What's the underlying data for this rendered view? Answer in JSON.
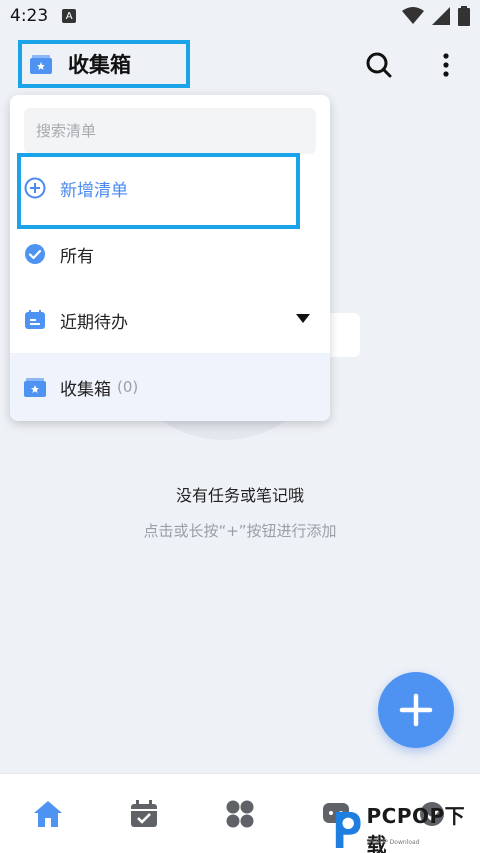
{
  "status_bar": {
    "time": "4:23",
    "notification_icon_letter": "A"
  },
  "app_bar": {
    "title": "收集箱",
    "title_icon": "inbox-star-icon",
    "actions": [
      "search-icon",
      "more-vertical-icon"
    ]
  },
  "dropdown": {
    "search_placeholder": "搜索清单",
    "items": [
      {
        "label": "新增清单",
        "icon": "add-circle-icon",
        "color": "#4a8af0"
      },
      {
        "label": "所有",
        "icon": "check-circle-icon"
      },
      {
        "label": "近期待办",
        "icon": "calendar-list-icon",
        "expand": "caret-down-icon"
      },
      {
        "label": "收集箱",
        "count": "(0)",
        "icon": "inbox-star-icon",
        "selected": true
      }
    ]
  },
  "empty_state": {
    "title": "没有任务或笔记哦",
    "subtitle": "点击或长按“+”按钮进行添加"
  },
  "bottom_nav": {
    "items": [
      "home-icon",
      "calendar-check-icon",
      "grid-icon",
      "chat-icon",
      "check-icon"
    ],
    "active": "home-icon"
  },
  "watermark": {
    "brand": "PCPOP",
    "suffix": "下载",
    "subtext": "PCPOP Download"
  },
  "colors": {
    "accent": "#4f93f2",
    "highlight_border": "#1aa3e8",
    "background": "#eef1f6"
  }
}
